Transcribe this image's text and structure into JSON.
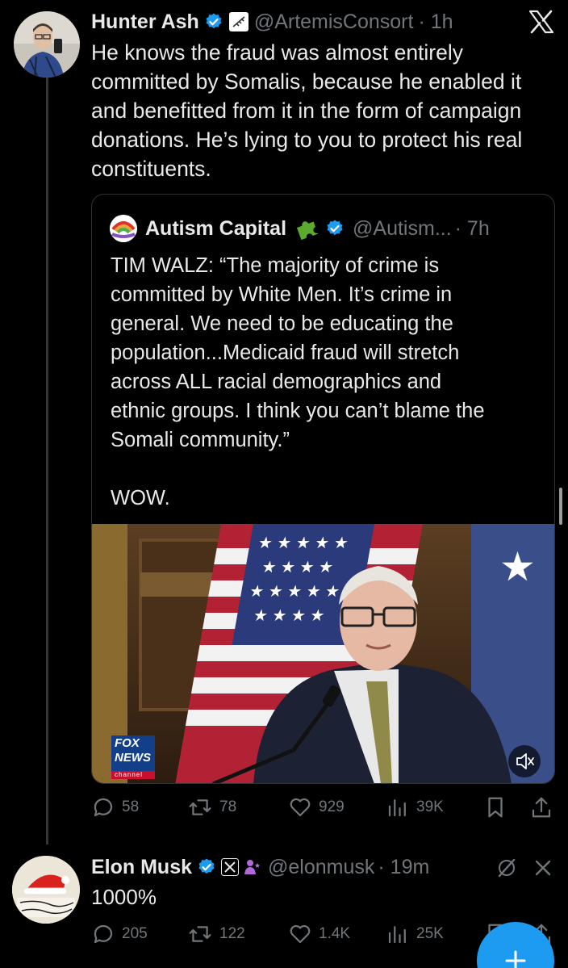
{
  "main_tweet": {
    "author": "Hunter Ash",
    "handle": "@ArtemisConsort",
    "time": "· 1h",
    "text": "He knows the fraud was almost entirely\ncommitted by Somalis, because he enabled it\nand benefitted from it in the form of campaign\ndonations. He’s lying to you to protect his real\nconstituents.",
    "stats": {
      "replies": "58",
      "reposts": "78",
      "likes": "929",
      "views": "39K"
    }
  },
  "quote": {
    "author": "Autism Capital",
    "handle": "@Autism...",
    "time": "· 7h",
    "text": "TIM WALZ: “The majority of crime is\ncommitted by White Men. It’s crime in\ngeneral. We need to be educating the\npopulation...Medicaid fraud will stretch\nacross ALL racial demographics and\nethnic groups. I think you can’t blame the\nSomali community.”\n\nWOW.",
    "video_logo": [
      "FOX",
      "NEWS",
      "channel"
    ]
  },
  "reply": {
    "author": "Elon Musk",
    "handle": "@elonmusk",
    "time": "· 19m",
    "text": "1000%",
    "stats": {
      "replies": "205",
      "reposts": "122",
      "likes": "1.4K",
      "views": "25K"
    }
  },
  "colors": {
    "accent": "#1d9bf0",
    "muted": "#71767b",
    "text": "#e7e9ea",
    "background": "#000000"
  }
}
